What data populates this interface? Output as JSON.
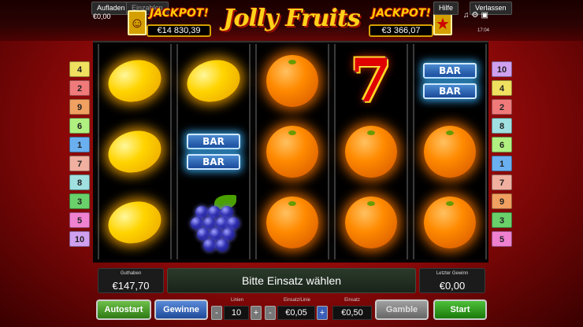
{
  "topbar": {
    "aufladen": "Aufladen",
    "einzahlen": "Einzahlen",
    "balance": "€0,00",
    "hilfe": "Hilfe",
    "verlassen": "Verlassen",
    "clock": "17:04"
  },
  "jackpot_left": {
    "title": "JACKPOT!",
    "value": "€14 830,39"
  },
  "jackpot_right": {
    "title": "JACKPOT!",
    "value": "€3 366,07"
  },
  "logo": "Jolly Fruits",
  "left_lines": [
    "4",
    "2",
    "9",
    "6",
    "1",
    "7",
    "8",
    "3",
    "5",
    "10"
  ],
  "right_lines": [
    "10",
    "4",
    "2",
    "8",
    "6",
    "1",
    "7",
    "9",
    "3",
    "5"
  ],
  "line_colors": {
    "1": "#6ab0f0",
    "2": "#f07a7a",
    "3": "#6ad06a",
    "4": "#f0e060",
    "5": "#f080d0",
    "6": "#b0f080",
    "7": "#f0b0a0",
    "8": "#a0e0e0",
    "9": "#f0a060",
    "10": "#d0a0f0"
  },
  "reels": [
    [
      "lemon",
      "lemon",
      "lemon"
    ],
    [
      "lemon",
      "bar",
      "grapes"
    ],
    [
      "orange",
      "orange",
      "orange"
    ],
    [
      "seven",
      "orange",
      "orange"
    ],
    [
      "bar",
      "orange",
      "orange"
    ]
  ],
  "bar_text": "BAR",
  "panel": {
    "guthaben_label": "Guthaben",
    "guthaben_value": "€147,70",
    "message": "Bitte Einsatz wählen",
    "last_win_label": "Letzter Gewinn",
    "last_win_value": "€0,00"
  },
  "controls": {
    "autostart": "Autostart",
    "gewinne": "Gewinne",
    "linien_label": "Linien",
    "linien_value": "10",
    "einsatz_linie_label": "Einsatz/Linie",
    "einsatz_linie_value": "€0,05",
    "einsatz_label": "Einsatz",
    "einsatz_value": "€0,50",
    "gamble": "Gamble",
    "start": "Start",
    "minus": "-",
    "plus": "+"
  }
}
